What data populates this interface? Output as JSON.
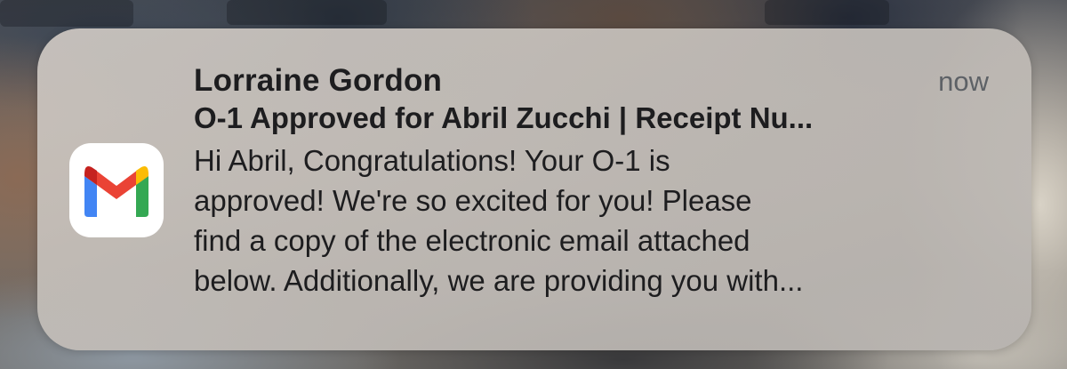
{
  "notification": {
    "app": "Gmail",
    "app_icon": "gmail-m-icon",
    "sender": "Lorraine Gordon",
    "timestamp": "now",
    "subject": "O-1 Approved for Abril Zucchi | Receipt Nu...",
    "preview_lines": [
      "Hi Abril, Congratulations! Your O-1 is",
      "approved! We're so excited for you! Please",
      "find a copy of the electronic email attached",
      "below. Additionally, we are providing you with..."
    ]
  },
  "colors": {
    "gmail_red": "#EA4335",
    "gmail_blue": "#4285F4",
    "gmail_green": "#34A853",
    "gmail_yellow": "#FBBC04",
    "gmail_dark_red": "#C5221F",
    "text_primary": "#1d1d1f",
    "text_secondary": "#5d6166"
  }
}
